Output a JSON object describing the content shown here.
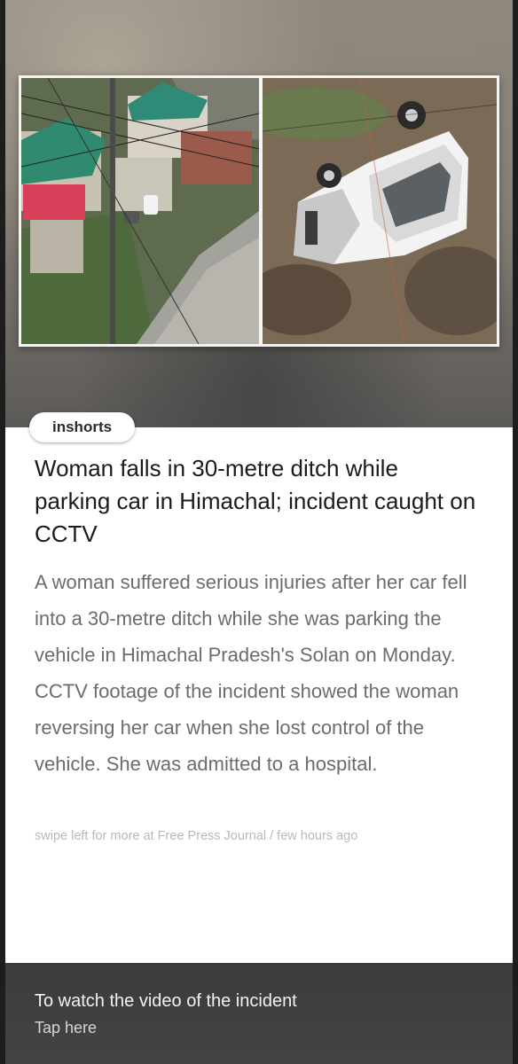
{
  "article": {
    "brand": "inshorts",
    "headline": "Woman falls in 30-metre ditch while parking car in Himachal; incident caught on CCTV",
    "body": "A woman suffered serious injuries after her car fell into a 30-metre ditch while she was parking the vehicle in Himachal Pradesh's Solan on Monday. CCTV footage of the incident showed the woman reversing her car when she lost control of the vehicle. She was admitted to a hospital.",
    "source_line": "swipe left for more at Free Press Journal / few hours ago"
  },
  "footer": {
    "title": "To watch the video of the incident",
    "subtitle": "Tap here"
  },
  "images": {
    "left_icon": "cctv-street-photo",
    "right_icon": "overturned-car-photo"
  }
}
